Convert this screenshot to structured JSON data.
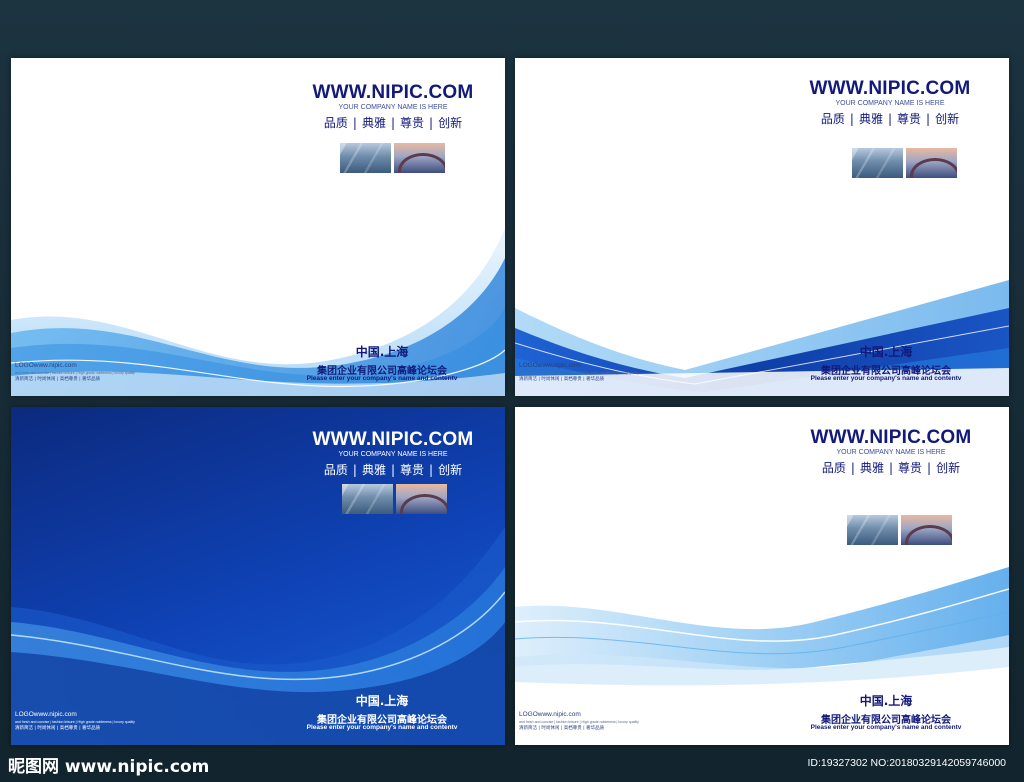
{
  "covers": [
    {
      "site": "WWW.NIPIC.COM",
      "tagline": "YOUR COMPANY NAME IS HERE",
      "values": [
        "品质",
        "典雅",
        "尊贵",
        "创新"
      ],
      "city": "中国.上海",
      "company": "集团企业有限公司高峰论坛会",
      "company_en": "Please enter your company's name and contentv",
      "logo": "LOGOwww.nipic.com",
      "fine_print": "and fresh and concise  |  fashion leisure  |  High grade nobleness  |  luxury quality",
      "mottos": "清新简洁 | 时尚休闲 | 高档尊贵 | 奢华品质"
    },
    {
      "site": "WWW.NIPIC.COM",
      "tagline": "YOUR COMPANY NAME IS HERE",
      "values": [
        "品质",
        "典雅",
        "尊贵",
        "创新"
      ],
      "city": "中国.上海",
      "company": "集团企业有限公司高峰论坛会",
      "company_en": "Please enter your company's name and contentv",
      "logo": "LOGOwww.nipic.com",
      "fine_print": "and fresh and concise  |  fashion leisure  |  High grade nobleness  |  luxury quality",
      "mottos": "清新简洁 | 时尚休闲 | 高档尊贵 | 奢华品质"
    },
    {
      "site": "WWW.NIPIC.COM",
      "tagline": "YOUR COMPANY NAME IS HERE",
      "values": [
        "品质",
        "典雅",
        "尊贵",
        "创新"
      ],
      "city": "中国.上海",
      "company": "集团企业有限公司高峰论坛会",
      "company_en": "Please enter your company's name and contentv",
      "logo": "LOGOwww.nipic.com",
      "fine_print": "and fresh and concise  |  fashion leisure  |  High grade nobleness  |  luxury quality",
      "mottos": "清新简洁 | 时尚休闲 | 高档尊贵 | 奢华品质"
    },
    {
      "site": "WWW.NIPIC.COM",
      "tagline": "YOUR COMPANY NAME IS HERE",
      "values": [
        "品质",
        "典雅",
        "尊贵",
        "创新"
      ],
      "city": "中国.上海",
      "company": "集团企业有限公司高峰论坛会",
      "company_en": "Please enter your company's name and contentv",
      "logo": "LOGOwww.nipic.com",
      "fine_print": "and fresh and concise  |  fashion leisure  |  High grade nobleness  |  luxury quality",
      "mottos": "清新简洁 | 时尚休闲 | 高档尊贵 | 奢华品质"
    }
  ],
  "footer": {
    "brand": "昵图网 www.nipic.com",
    "id_line": "ID:19327302 NO:20180329142059746000"
  },
  "colors": {
    "navy_text": "#12197a",
    "wave_blue": "#1a6fd6",
    "deep_blue": "#0c2a7e",
    "backdrop": "#1c3340"
  }
}
